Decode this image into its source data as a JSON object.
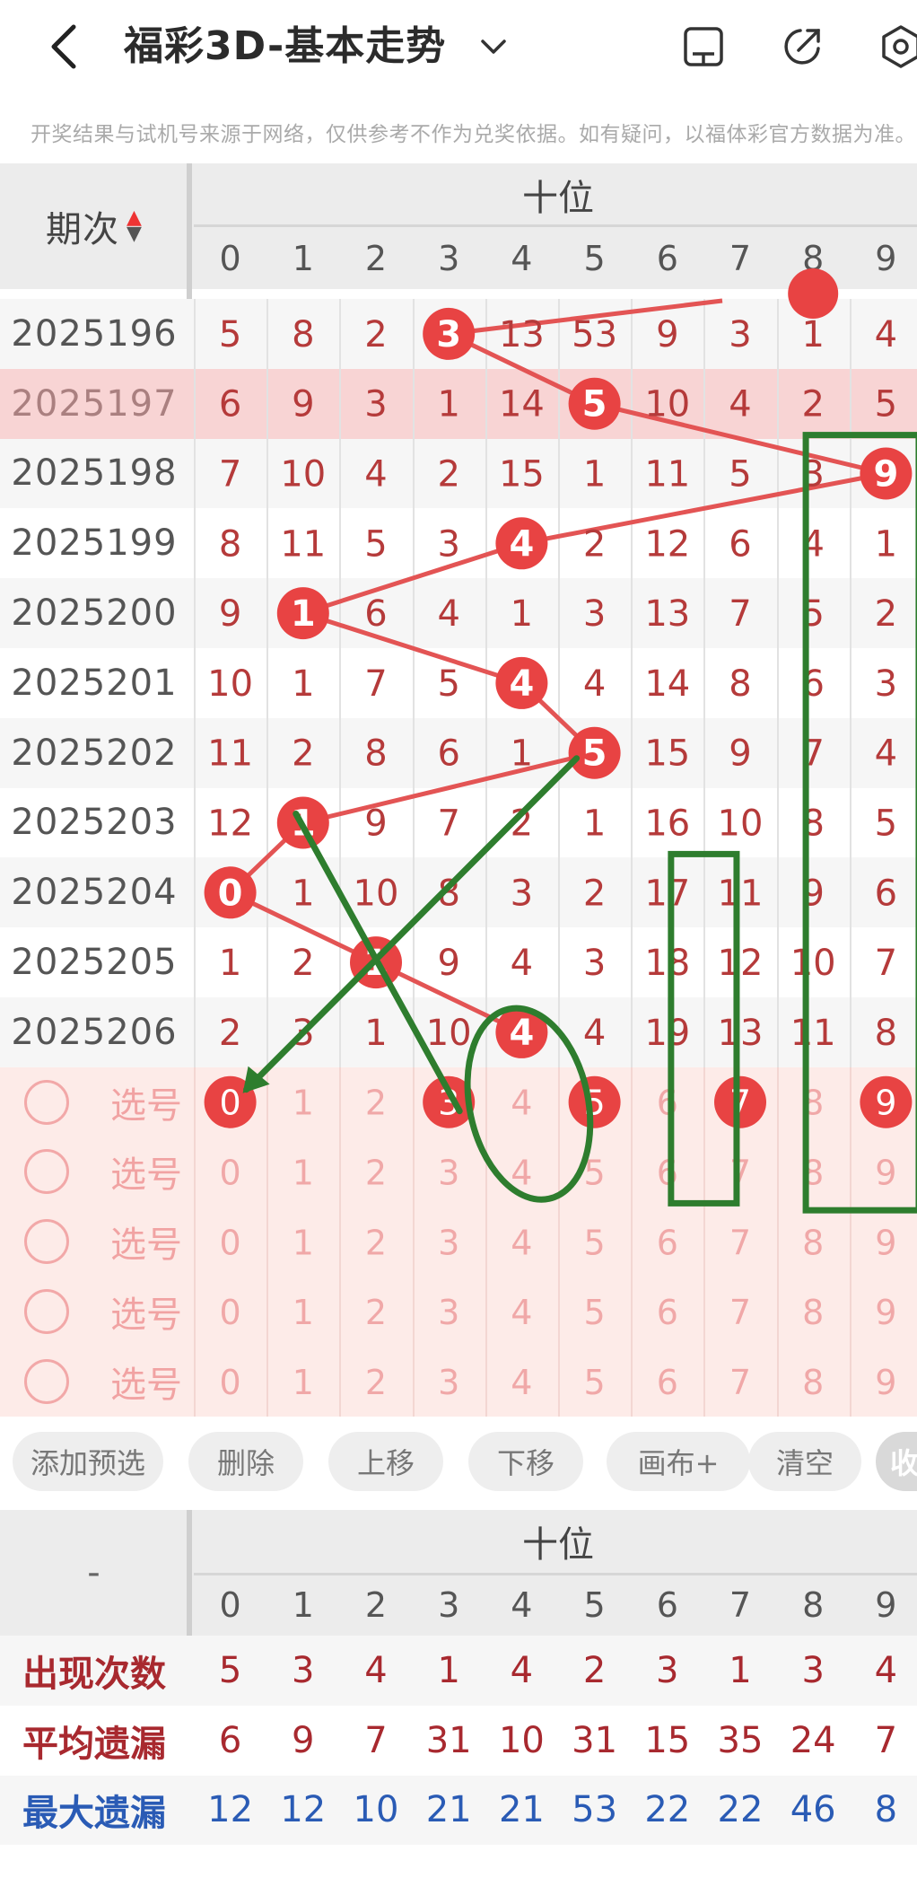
{
  "header": {
    "title": "福彩3D-基本走势"
  },
  "notice": "开奖结果与试机号来源于网络，仅供参考不作为兑奖依据。如有疑问，以福体彩官方数据为准。",
  "table": {
    "period_label": "期次",
    "group_label": "十位",
    "digits": [
      "0",
      "1",
      "2",
      "3",
      "4",
      "5",
      "6",
      "7",
      "8",
      "9"
    ],
    "rows": [
      {
        "period": "2025196",
        "cells": [
          "5",
          "8",
          "2",
          "3",
          "13",
          "53",
          "9",
          "3",
          "1",
          "4"
        ],
        "hit": 3
      },
      {
        "period": "2025197",
        "cells": [
          "6",
          "9",
          "3",
          "1",
          "14",
          "5",
          "10",
          "4",
          "2",
          "5"
        ],
        "hit": 5,
        "highlight": true
      },
      {
        "period": "2025198",
        "cells": [
          "7",
          "10",
          "4",
          "2",
          "15",
          "1",
          "11",
          "5",
          "3",
          "9"
        ],
        "hit": 9
      },
      {
        "period": "2025199",
        "cells": [
          "8",
          "11",
          "5",
          "3",
          "4",
          "2",
          "12",
          "6",
          "4",
          "1"
        ],
        "hit": 4
      },
      {
        "period": "2025200",
        "cells": [
          "9",
          "1",
          "6",
          "4",
          "1",
          "3",
          "13",
          "7",
          "5",
          "2"
        ],
        "hit": 1
      },
      {
        "period": "2025201",
        "cells": [
          "10",
          "1",
          "7",
          "5",
          "4",
          "4",
          "14",
          "8",
          "6",
          "3"
        ],
        "hit": 4
      },
      {
        "period": "2025202",
        "cells": [
          "11",
          "2",
          "8",
          "6",
          "1",
          "5",
          "15",
          "9",
          "7",
          "4"
        ],
        "hit": 5
      },
      {
        "period": "2025203",
        "cells": [
          "12",
          "1",
          "9",
          "7",
          "2",
          "1",
          "16",
          "10",
          "8",
          "5"
        ],
        "hit": 1
      },
      {
        "period": "2025204",
        "cells": [
          "0",
          "1",
          "10",
          "8",
          "3",
          "2",
          "17",
          "11",
          "9",
          "6"
        ],
        "hit": 0
      },
      {
        "period": "2025205",
        "cells": [
          "1",
          "2",
          "1",
          "9",
          "4",
          "3",
          "18",
          "12",
          "10",
          "7"
        ],
        "hit": 2
      },
      {
        "period": "2025206",
        "cells": [
          "2",
          "3",
          "1",
          "10",
          "4",
          "4",
          "19",
          "13",
          "11",
          "8"
        ],
        "hit": 4
      }
    ],
    "select_label": "选号",
    "select_rows": [
      {
        "cells": [
          "0",
          "1",
          "2",
          "3",
          "4",
          "5",
          "6",
          "7",
          "8",
          "9"
        ],
        "chosen": [
          0,
          3,
          5,
          7,
          9
        ]
      },
      {
        "cells": [
          "0",
          "1",
          "2",
          "3",
          "4",
          "5",
          "6",
          "7",
          "8",
          "9"
        ],
        "chosen": []
      },
      {
        "cells": [
          "0",
          "1",
          "2",
          "3",
          "4",
          "5",
          "6",
          "7",
          "8",
          "9"
        ],
        "chosen": []
      },
      {
        "cells": [
          "0",
          "1",
          "2",
          "3",
          "4",
          "5",
          "6",
          "7",
          "8",
          "9"
        ],
        "chosen": []
      },
      {
        "cells": [
          "0",
          "1",
          "2",
          "3",
          "4",
          "5",
          "6",
          "7",
          "8",
          "9"
        ],
        "chosen": []
      }
    ]
  },
  "actions": [
    "添加预选",
    "删除",
    "上移",
    "下移",
    "画布+",
    "清空",
    "收"
  ],
  "stats": {
    "corner": "-",
    "group_label": "十位",
    "digits": [
      "0",
      "1",
      "2",
      "3",
      "4",
      "5",
      "6",
      "7",
      "8",
      "9"
    ],
    "rows": [
      {
        "label": "出现次数",
        "color": "#a8292f",
        "values": [
          "5",
          "3",
          "4",
          "1",
          "4",
          "2",
          "3",
          "1",
          "3",
          "4"
        ]
      },
      {
        "label": "平均遗漏",
        "color": "#a8292f",
        "values": [
          "6",
          "9",
          "7",
          "31",
          "10",
          "31",
          "15",
          "35",
          "24",
          "7"
        ]
      },
      {
        "label": "最大遗漏",
        "color": "#2a5bb5",
        "values": [
          "12",
          "12",
          "10",
          "21",
          "21",
          "53",
          "22",
          "22",
          "46",
          "8"
        ]
      }
    ]
  },
  "colors": {
    "hit": "#e84343",
    "line": "#e35454",
    "annotation": "#2e7d2e",
    "highlight_row": "#f8d4d4",
    "select_bg": "#fdebe8"
  }
}
